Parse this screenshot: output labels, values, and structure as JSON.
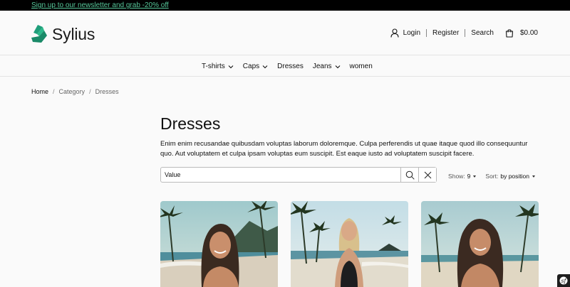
{
  "topbar": {
    "promo_text": "Sign up to our newsletter and grab -20% off"
  },
  "header": {
    "logo_text": "Sylius",
    "login_label": "Login",
    "register_label": "Register",
    "search_label": "Search",
    "cart_total": "$0.00"
  },
  "nav": {
    "items": [
      {
        "label": "T-shirts",
        "has_dropdown": true
      },
      {
        "label": "Caps",
        "has_dropdown": true
      },
      {
        "label": "Dresses",
        "has_dropdown": false
      },
      {
        "label": "Jeans",
        "has_dropdown": true
      },
      {
        "label": "women",
        "has_dropdown": false
      }
    ]
  },
  "breadcrumb": {
    "home": "Home",
    "category": "Category",
    "current": "Dresses"
  },
  "main": {
    "title": "Dresses",
    "description": "Enim enim recusandae quibusdam voluptas laborum doloremque. Culpa perferendis ut quae itaque quod illo consequuntur quo. Aut voluptatem et culpa ipsam voluptas eum suscipit. Est eaque iusto ad voluptatem suscipit facere."
  },
  "search": {
    "value": "Value"
  },
  "controls": {
    "show_label": "Show:",
    "show_value": "9",
    "sort_label": "Sort:",
    "sort_value": "by position"
  },
  "products": [
    {
      "image": "woman-on-beach-smiling"
    },
    {
      "image": "woman-on-beach-black-swimsuit"
    },
    {
      "image": "woman-on-beach-palms"
    }
  ],
  "colors": {
    "accent": "#56c79a",
    "logo": "#1f9e7a",
    "topbar_bg": "#000000"
  }
}
